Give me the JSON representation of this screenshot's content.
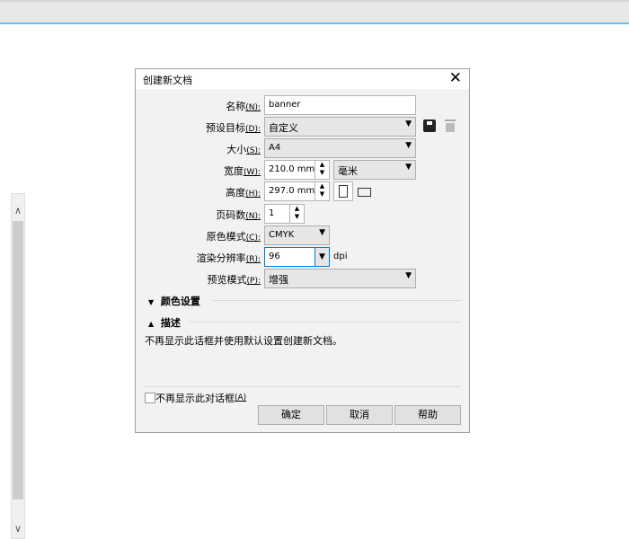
{
  "dialog": {
    "title": "创建新文档",
    "fields": {
      "name": {
        "label": "名称",
        "key": "(N):",
        "value": "banner"
      },
      "preset": {
        "label": "预设目标",
        "key": "(D):",
        "value": "自定义"
      },
      "size": {
        "label": "大小",
        "key": "(S):",
        "value": "A4"
      },
      "width": {
        "label": "宽度",
        "key": "(W):",
        "value": "210.0 mm",
        "unit": "毫米"
      },
      "height": {
        "label": "高度",
        "key": "(H):",
        "value": "297.0 mm"
      },
      "pages": {
        "label": "页码数",
        "key": "(N):",
        "value": "1"
      },
      "color_mode": {
        "label": "原色模式",
        "key": "(C):",
        "value": "CMYK"
      },
      "resolution": {
        "label": "渲染分辨率",
        "key": "(R):",
        "value": "96",
        "unit": "dpi"
      },
      "preview": {
        "label": "预览模式",
        "key": "(P):",
        "value": "增强"
      }
    },
    "sections": {
      "color": "颜色设置",
      "desc": "描述"
    },
    "description": "不再显示此话框并使用默认设置创建新文档。",
    "checkbox": {
      "label": "不再显示此对话框",
      "key": "(A)",
      "checked": false
    },
    "buttons": {
      "ok": "确定",
      "cancel": "取消",
      "help": "帮助"
    }
  }
}
